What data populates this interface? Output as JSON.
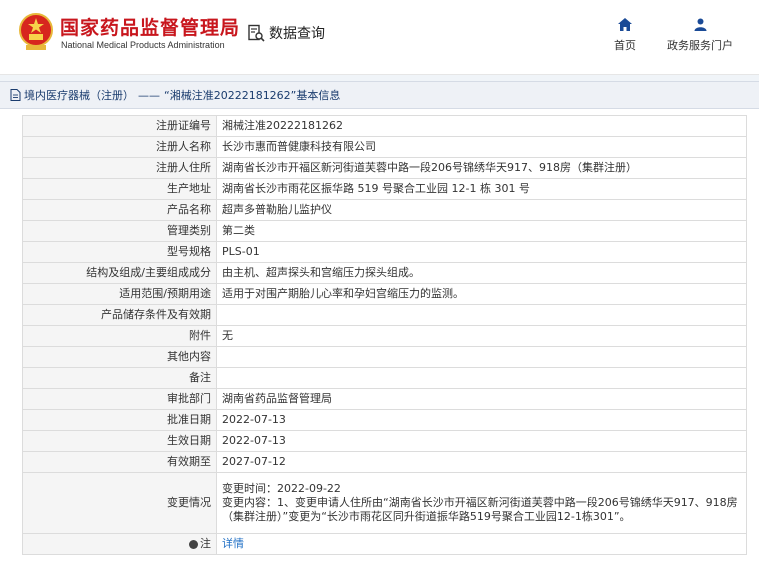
{
  "header": {
    "title": "国家药品监督管理局",
    "subtitle": "National Medical Products Administration",
    "data_query": "数据查询",
    "nav": [
      {
        "label": "首页",
        "icon": "home-icon"
      },
      {
        "label": "政务服务门户",
        "icon": "user-icon"
      }
    ]
  },
  "breadcrumb": {
    "section": "境内医疗器械（注册）",
    "separator": "——",
    "title": "“湘械注准20222181262”基本信息"
  },
  "details": {
    "reg_no": {
      "label": "注册证编号",
      "value": "湘械注准20222181262"
    },
    "registrant": {
      "label": "注册人名称",
      "value": "长沙市惠而普健康科技有限公司"
    },
    "address": {
      "label": "注册人住所",
      "value": "湖南省长沙市开福区新河街道芙蓉中路一段206号锦绣华天917、918房（集群注册）"
    },
    "prod_addr": {
      "label": "生产地址",
      "value": "湖南省长沙市雨花区振华路 519 号聚合工业园 12-1 栋 301 号"
    },
    "product": {
      "label": "产品名称",
      "value": "超声多普勒胎儿监护仪"
    },
    "category": {
      "label": "管理类别",
      "value": "第二类"
    },
    "model": {
      "label": "型号规格",
      "value": "PLS-01"
    },
    "structure": {
      "label": "结构及组成/主要组成成分",
      "value": "由主机、超声探头和宫缩压力探头组成。"
    },
    "scope": {
      "label": "适用范围/预期用途",
      "value": "适用于对围产期胎儿心率和孕妇宫缩压力的监测。"
    },
    "storage": {
      "label": "产品储存条件及有效期",
      "value": ""
    },
    "attachment": {
      "label": "附件",
      "value": "无"
    },
    "other": {
      "label": "其他内容",
      "value": ""
    },
    "remark": {
      "label": "备注",
      "value": ""
    },
    "dept": {
      "label": "审批部门",
      "value": "湖南省药品监督管理局"
    },
    "approve_date": {
      "label": "批准日期",
      "value": "2022-07-13"
    },
    "effective_date": {
      "label": "生效日期",
      "value": "2022-07-13"
    },
    "expire_date": {
      "label": "有效期至",
      "value": "2027-07-12"
    },
    "change": {
      "label": "变更情况",
      "time": "变更时间：2022-09-22",
      "content": "变更内容：1、变更申请人住所由“湖南省长沙市开福区新河街道芙蓉中路一段206号锦绣华天917、918房（集群注册）”变更为“长沙市雨花区同升街道振华路519号聚合工业园12-1栋301”。"
    },
    "note": {
      "label": "注",
      "link": "详情"
    }
  }
}
